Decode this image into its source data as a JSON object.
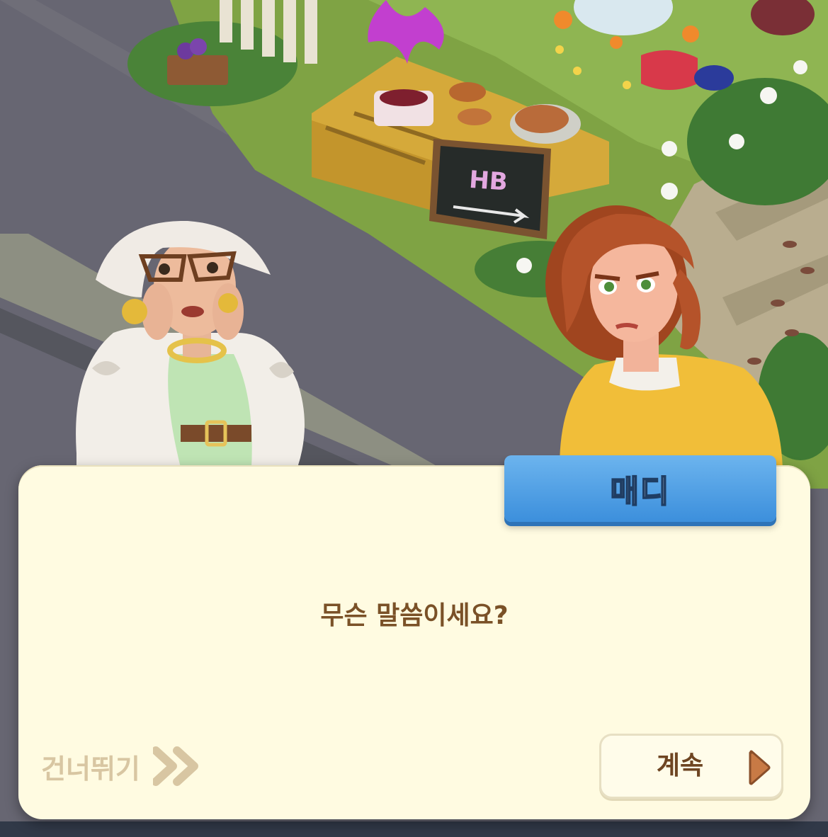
{
  "speaker": {
    "name": "매디"
  },
  "dialog": {
    "line": "무슨 말씀이세요?"
  },
  "controls": {
    "skip_label": "건너뛰기",
    "continue_label": "계속"
  },
  "scene": {
    "sign_text": "HB"
  },
  "colors": {
    "dialog_bg": "#fffbe1",
    "nameplate": "#4a9be4",
    "dialog_text": "#7a5127",
    "skip_text": "#d8c6a2",
    "continue_arrow": "#c87a45"
  }
}
